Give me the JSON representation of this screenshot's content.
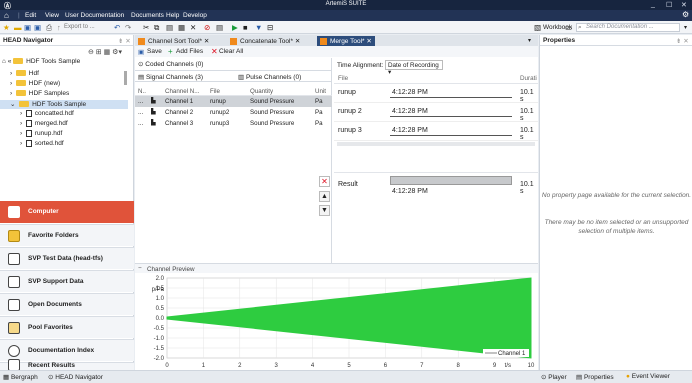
{
  "app": {
    "title": "ArtemiS SUITE",
    "window_controls": [
      "_",
      "☐",
      "✕"
    ]
  },
  "menu": [
    "Edit",
    "View",
    "User Documentation",
    "Documents",
    "Help",
    "Develop"
  ],
  "toolbar": {
    "export": "Export to ...",
    "workbook": "Workbook",
    "search_placeholder": "Search Documentation ..."
  },
  "nav": {
    "title": "HEAD Navigator",
    "path": "HDF Tools Sample",
    "tree": [
      {
        "label": "Hdf",
        "type": "folder",
        "indent": 1
      },
      {
        "label": "HDF (new)",
        "type": "folder",
        "indent": 1
      },
      {
        "label": "HDF Samples",
        "type": "folder",
        "indent": 1
      },
      {
        "label": "HDF Tools Sample",
        "type": "folder",
        "indent": 1,
        "selected": true
      },
      {
        "label": "concatted.hdf",
        "type": "file",
        "indent": 2
      },
      {
        "label": "merged.hdf",
        "type": "file",
        "indent": 2
      },
      {
        "label": "runup.hdf",
        "type": "file",
        "indent": 2
      },
      {
        "label": "sorted.hdf",
        "type": "file",
        "indent": 2
      }
    ],
    "buttons": [
      "Computer",
      "Favorite Folders",
      "SVP Test Data (head-tfs)",
      "SVP Support Data",
      "Open Documents",
      "Pool Favorites",
      "Documentation Index",
      "Recent Results"
    ]
  },
  "tabs": [
    {
      "label": "Channel Sort Tool*",
      "active": false
    },
    {
      "label": "Concatenate Tool*",
      "active": false
    },
    {
      "label": "Merge Tool*",
      "active": true
    }
  ],
  "doc_toolbar": {
    "save": "Save",
    "add_files": "Add Files",
    "clear_all": "Clear All"
  },
  "left_section": {
    "coded": "Coded Channels (0)",
    "signal": "Signal Channels (3)",
    "pulse": "Pulse Channels (0)",
    "columns": [
      "N..",
      "Channel N...",
      "File",
      "Quantity",
      "Unit"
    ],
    "rows": [
      {
        "n": "...",
        "name": "Channel 1",
        "file": "runup",
        "quantity": "Sound Pressure",
        "unit": "Pa",
        "selected": true
      },
      {
        "n": "...",
        "name": "Channel 2",
        "file": "runup2",
        "quantity": "Sound Pressure",
        "unit": "Pa",
        "selected": false
      },
      {
        "n": "...",
        "name": "Channel 3",
        "file": "runup3",
        "quantity": "Sound Pressure",
        "unit": "Pa",
        "selected": false
      }
    ]
  },
  "right_section": {
    "time_alignment_label": "Time Alignment:",
    "time_alignment_value": "Date of Recording",
    "columns": [
      "File",
      "Durati"
    ],
    "rows": [
      {
        "file": "runup",
        "time": "4:12:28 PM",
        "duration": "10.1 s"
      },
      {
        "file": "runup 2",
        "time": "4:12:28 PM",
        "duration": "10.1 s"
      },
      {
        "file": "runup 3",
        "time": "4:12:28 PM",
        "duration": "10.1 s"
      }
    ],
    "result": {
      "label": "Result",
      "time": "4:12:28 PM",
      "duration": "10.1 s"
    }
  },
  "preview": {
    "title": "Channel Preview"
  },
  "chart_data": {
    "type": "area",
    "ylabel": "p/Pa",
    "xlabel": "t/s",
    "xlim": [
      0,
      10
    ],
    "ylim": [
      -2.0,
      2.0
    ],
    "x_ticks": [
      "0",
      "1",
      "2",
      "3",
      "4",
      "5",
      "6",
      "7",
      "8",
      "9",
      "10"
    ],
    "y_ticks": [
      "2.0",
      "1.5",
      "1.0",
      "0.5",
      "0.0",
      "-0.5",
      "-1.0",
      "-1.5",
      "-2.0"
    ],
    "series": [
      {
        "name": "Channel 1",
        "color": "#2ecc40",
        "envelope_start": 0.05,
        "envelope_end": 2.0
      }
    ]
  },
  "properties": {
    "title": "Properties",
    "msg1": "No property page available for the current selection.",
    "msg2": "There may be no item selected or an unsupported selection of multiple items."
  },
  "status": {
    "left_tab1": "Bergraph",
    "left_tab2": "HEAD Navigator",
    "right_tab1": "Player",
    "right_tab2": "Properties",
    "right_tab3": "Event Viewer",
    "size": "Size: 1200 x 671"
  }
}
